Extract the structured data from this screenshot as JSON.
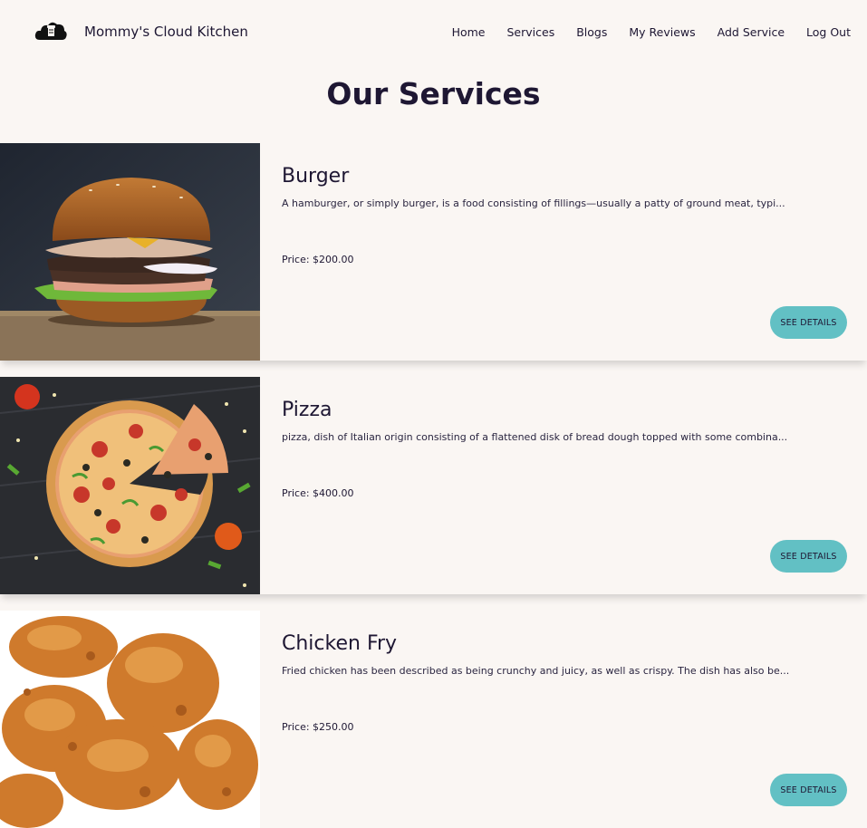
{
  "navbar": {
    "brand_name": "Mommy's Cloud Kitchen",
    "logo_icon": "cloud-kitchen-logo-icon",
    "links": [
      "Home",
      "Services",
      "Blogs",
      "My Reviews",
      "Add Service",
      "Log Out"
    ]
  },
  "page": {
    "title": "Our Services"
  },
  "services": [
    {
      "name": "Burger",
      "description": "A hamburger, or simply burger, is a food consisting of fillings—usually a patty of ground meat, typi...",
      "price": "Price: $200.00",
      "button": "SEE DETAILS"
    },
    {
      "name": "Pizza",
      "description": "pizza, dish of Italian origin consisting of a flattened disk of bread dough topped with some combina...",
      "price": "Price: $400.00",
      "button": "SEE DETAILS"
    },
    {
      "name": "Chicken Fry",
      "description": "Fried chicken has been described as being crunchy and juicy, as well as crispy. The dish has also be...",
      "price": "Price: $250.00",
      "button": "SEE DETAILS"
    }
  ],
  "colors": {
    "background": "#faf6f3",
    "text": "#1e1733",
    "button": "#62c0c4"
  }
}
